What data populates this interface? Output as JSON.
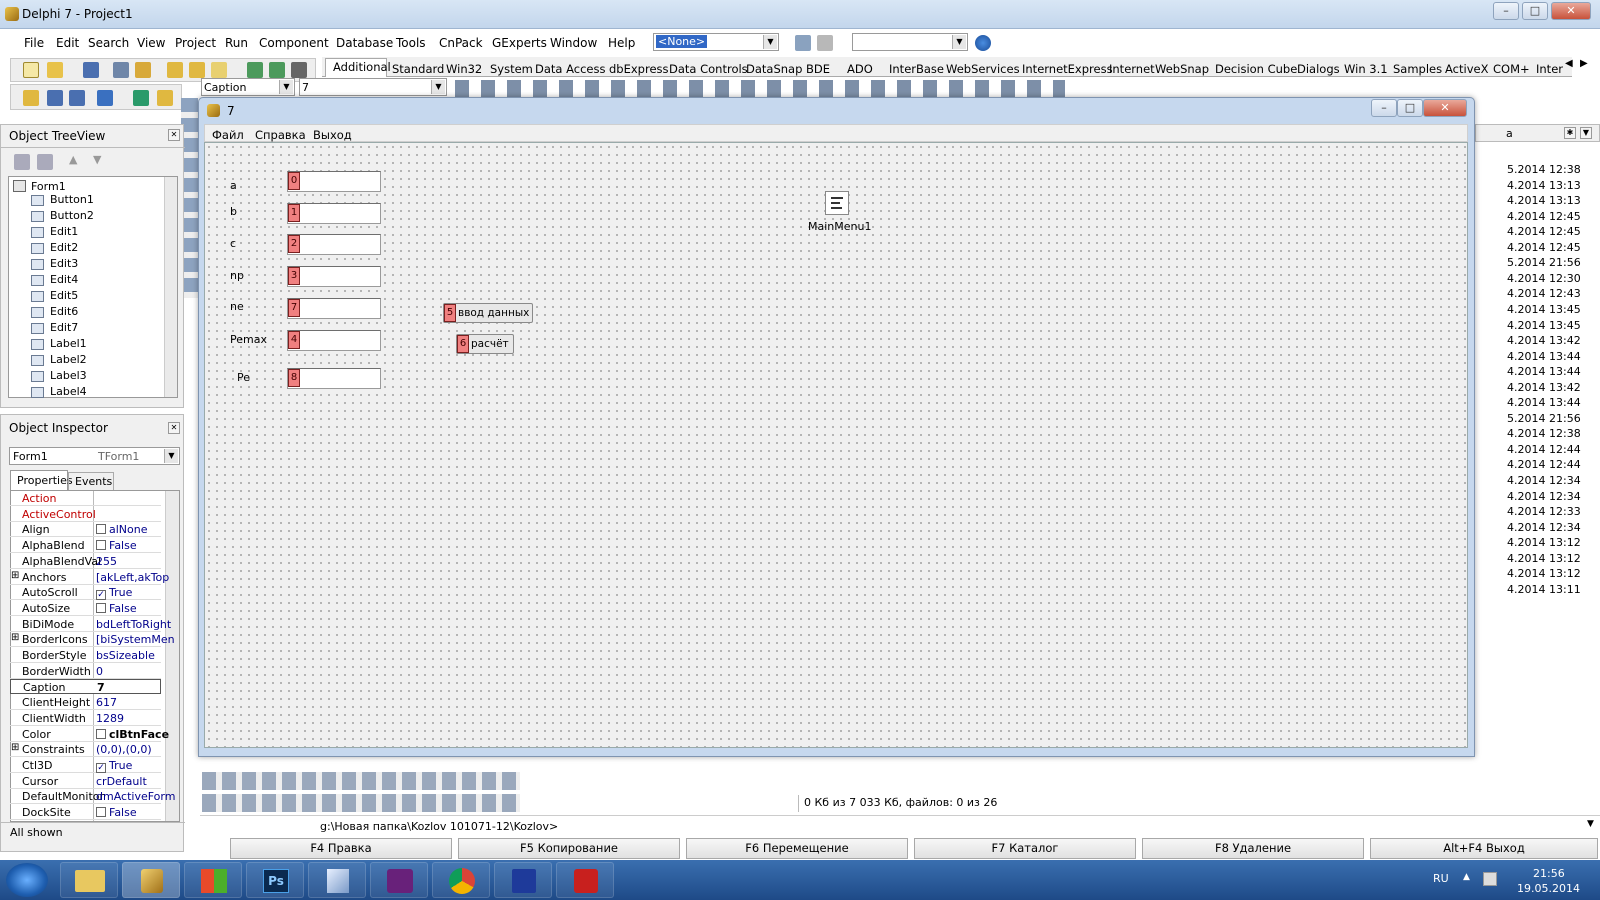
{
  "window": {
    "title": "Delphi 7 - Project1"
  },
  "menu": [
    "File",
    "Edit",
    "Search",
    "View",
    "Project",
    "Run",
    "Component",
    "Database",
    "Tools",
    "CnPack",
    "GExperts",
    "Window",
    "Help"
  ],
  "toolbar": {
    "config_combo": "<None>",
    "caption_combo": "Caption",
    "caption_value": "7"
  },
  "palette_tabs": [
    "Additional",
    "Standard",
    "Win32",
    "System",
    "Data Access",
    "dbExpress",
    "Data Controls",
    "DataSnap",
    "BDE",
    "ADO",
    "InterBase",
    "WebServices",
    "InternetExpress",
    "Internet",
    "WebSnap",
    "Decision Cube",
    "Dialogs",
    "Win 3.1",
    "Samples",
    "ActiveX",
    "COM+",
    "Inter"
  ],
  "tree_view": {
    "title": "Object TreeView",
    "root": "Form1",
    "items": [
      "Button1",
      "Button2",
      "Edit1",
      "Edit2",
      "Edit3",
      "Edit4",
      "Edit5",
      "Edit6",
      "Edit7",
      "Label1",
      "Label2",
      "Label3",
      "Label4"
    ]
  },
  "inspector": {
    "title": "Object Inspector",
    "object": "Form1",
    "object_type": "TForm1",
    "tabs": [
      "Properties",
      "Events"
    ],
    "props": [
      {
        "name": "Action",
        "value": "",
        "red": true
      },
      {
        "name": "ActiveControl",
        "value": "",
        "red": true
      },
      {
        "name": "Align",
        "value": "alNone",
        "check": ""
      },
      {
        "name": "AlphaBlend",
        "value": "False",
        "check": ""
      },
      {
        "name": "AlphaBlendVal",
        "value": "255"
      },
      {
        "name": "Anchors",
        "value": "[akLeft,akTop",
        "expand": "⊞"
      },
      {
        "name": "AutoScroll",
        "value": "True",
        "check": "✓"
      },
      {
        "name": "AutoSize",
        "value": "False",
        "check": ""
      },
      {
        "name": "BiDiMode",
        "value": "bdLeftToRight"
      },
      {
        "name": "BorderIcons",
        "value": "[biSystemMen",
        "expand": "⊞"
      },
      {
        "name": "BorderStyle",
        "value": "bsSizeable"
      },
      {
        "name": "BorderWidth",
        "value": "0"
      },
      {
        "name": "Caption",
        "value": "7",
        "bold": true
      },
      {
        "name": "ClientHeight",
        "value": "617"
      },
      {
        "name": "ClientWidth",
        "value": "1289"
      },
      {
        "name": "Color",
        "value": "clBtnFace",
        "check": "",
        "bold": true
      },
      {
        "name": "Constraints",
        "value": "(0,0),(0,0)",
        "expand": "⊞"
      },
      {
        "name": "Ctl3D",
        "value": "True",
        "check": "✓"
      },
      {
        "name": "Cursor",
        "value": "crDefault"
      },
      {
        "name": "DefaultMonitor",
        "value": "dmActiveForm"
      },
      {
        "name": "DockSite",
        "value": "False",
        "check": ""
      }
    ],
    "status": "All shown"
  },
  "form": {
    "title": "7",
    "menu": [
      "Файл",
      "Справка",
      "Выход"
    ],
    "labels": [
      "a",
      "b",
      "c",
      "np",
      "ne",
      "Pemax",
      "Pe"
    ],
    "edit_taborders": [
      "0",
      "1",
      "2",
      "3",
      "7",
      "4",
      "8"
    ],
    "buttons": [
      {
        "taborder": "5",
        "caption": "ввод данных"
      },
      {
        "taborder": "6",
        "caption": "расчёт"
      }
    ],
    "component": "MainMenu1"
  },
  "right_panel": {
    "header": "а",
    "timestamps": [
      "5.2014 12:38",
      "4.2014 13:13",
      "4.2014 13:13",
      "4.2014 12:45",
      "4.2014 12:45",
      "4.2014 12:45",
      "5.2014 21:56",
      "4.2014 12:30",
      "4.2014 12:43",
      "4.2014 13:45",
      "4.2014 13:45",
      "4.2014 13:42",
      "4.2014 13:44",
      "4.2014 13:44",
      "4.2014 13:42",
      "4.2014 13:44",
      "5.2014 21:56",
      "4.2014 12:38",
      "4.2014 12:44",
      "4.2014 12:44",
      "4.2014 12:34",
      "4.2014 12:34",
      "4.2014 12:33",
      "4.2014 12:34",
      "4.2014 13:12",
      "4.2014 13:12",
      "4.2014 13:12",
      "4.2014 13:11"
    ]
  },
  "status": {
    "files": "0 Кб из 7 033 Кб, файлов: 0 из 26",
    "path": "g:\\Новая папка\\Kozlov 101071-12\\Kozlov>"
  },
  "fkeys": [
    "F4 Правка",
    "F5 Копирование",
    "F6 Перемещение",
    "F7 Каталог",
    "F8 Удаление",
    "Alt+F4 Выход"
  ],
  "taskbar": {
    "lang": "RU",
    "time": "21:56",
    "date": "19.05.2014"
  },
  "colors": {
    "tab_order": "#f08080",
    "prop_name_red": "#c00000",
    "prop_value": "#00008b"
  }
}
